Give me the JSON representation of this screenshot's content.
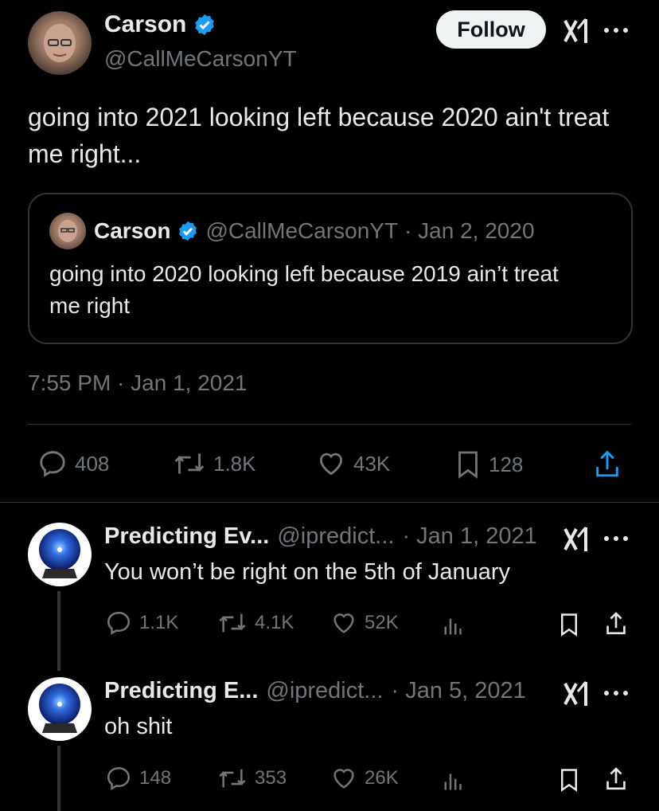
{
  "main_tweet": {
    "author_name": "Carson",
    "author_handle": "@CallMeCarsonYT",
    "follow_label": "Follow",
    "text": "going into 2021 looking left because 2020 ain't treat me right...",
    "timestamp": "7:55 PM · Jan 1, 2021",
    "stats": {
      "replies": "408",
      "retweets": "1.8K",
      "likes": "43K",
      "bookmarks": "128"
    },
    "quoted": {
      "author_name": "Carson",
      "author_handle": "@CallMeCarsonYT",
      "date": "· Jan 2, 2020",
      "text": "going into 2020 looking left because 2019 ain’t treat me right"
    }
  },
  "replies": [
    {
      "author_name": "Predicting Ev...",
      "author_handle": "@ipredict...",
      "date": "· Jan 1, 2021",
      "text": "You won’t be right on the 5th of January",
      "replies": "1.1K",
      "retweets": "4.1K",
      "likes": "52K"
    },
    {
      "author_name": "Predicting E...",
      "author_handle": "@ipredict...",
      "date": "· Jan 5, 2021",
      "text": "oh shit",
      "replies": "148",
      "retweets": "353",
      "likes": "26K"
    }
  ],
  "colors": {
    "background": "#000000",
    "text": "#e7e9ea",
    "muted": "#71767b",
    "verified": "#1d9bf0",
    "border": "#2f3336"
  }
}
